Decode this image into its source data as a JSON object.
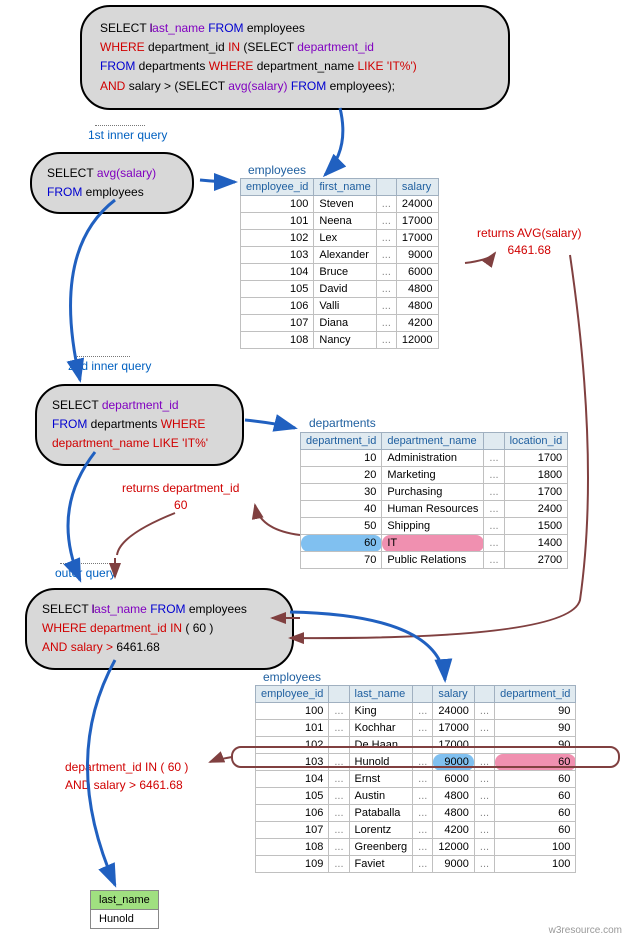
{
  "main_query": {
    "l1a": "SELECT",
    "l1b": "last_name",
    "l1c": "FROM",
    "l1d": "employees",
    "l2a": "WHERE",
    "l2b": "department_id",
    "l2c": "IN",
    "l2d": "(SELECT",
    "l2e": "department_id",
    "l3a": "FROM",
    "l3b": "departments",
    "l3c": "WHERE",
    "l3d": "department_name",
    "l3e": "LIKE",
    "l3f": "'IT%')",
    "l4a": "AND",
    "l4b": "salary >",
    "l4c": "(SELECT",
    "l4d": "avg(salary)",
    "l4e": "FROM",
    "l4f": "employees);"
  },
  "labels": {
    "q1": "1st inner query",
    "q2": "2nd inner query",
    "q3": "outer query",
    "t_emp": "employees",
    "t_dep": "departments",
    "ret_avg": "returns AVG(salary)",
    "ret_avg_val": "6461.68",
    "ret_dept": "returns department_id",
    "ret_dept_val": "60",
    "cond1": "department_id IN ( 60 )",
    "cond2": "AND salary > 6461.68"
  },
  "inner1": {
    "l1a": "SELECT",
    "l1b": "avg(salary)",
    "l2a": "FROM",
    "l2b": "employees"
  },
  "inner2": {
    "l1a": "SELECT",
    "l1b": "department_id",
    "l2a": "FROM",
    "l2b": "departments",
    "l2c": "WHERE",
    "l3a": "department_name",
    "l3b": "LIKE",
    "l3c": "'IT%'"
  },
  "outer": {
    "l1a": "SELECT",
    "l1b": "last_name",
    "l1c": "FROM",
    "l1d": "employees",
    "l2a": "WHERE",
    "l2b": "department_id",
    "l2c": "IN",
    "l2d": "( 60 )",
    "l3a": "AND",
    "l3b": "salary >",
    "l3c": "6461.68"
  },
  "emp1": {
    "headers": [
      "employee_id",
      "first_name",
      "",
      "salary"
    ],
    "rows": [
      [
        "100",
        "Steven",
        "...",
        "24000"
      ],
      [
        "101",
        "Neena",
        "...",
        "17000"
      ],
      [
        "102",
        "Lex",
        "...",
        "17000"
      ],
      [
        "103",
        "Alexander",
        "...",
        "9000"
      ],
      [
        "104",
        "Bruce",
        "...",
        "6000"
      ],
      [
        "105",
        "David",
        "...",
        "4800"
      ],
      [
        "106",
        "Valli",
        "...",
        "4800"
      ],
      [
        "107",
        "Diana",
        "...",
        "4200"
      ],
      [
        "108",
        "Nancy",
        "...",
        "12000"
      ]
    ]
  },
  "dep": {
    "headers": [
      "department_id",
      "department_name",
      "",
      "location_id"
    ],
    "rows": [
      [
        "10",
        "Administration",
        "...",
        "1700"
      ],
      [
        "20",
        "Marketing",
        "...",
        "1800"
      ],
      [
        "30",
        "Purchasing",
        "...",
        "1700"
      ],
      [
        "40",
        "Human Resources",
        "...",
        "2400"
      ],
      [
        "50",
        "Shipping",
        "...",
        "1500"
      ],
      [
        "60",
        "IT",
        "...",
        "1400"
      ],
      [
        "70",
        "Public Relations",
        "...",
        "2700"
      ]
    ]
  },
  "emp2": {
    "headers": [
      "employee_id",
      "",
      "last_name",
      "",
      "salary",
      "",
      "department_id"
    ],
    "rows": [
      [
        "100",
        "...",
        "King",
        "...",
        "24000",
        "...",
        "90"
      ],
      [
        "101",
        "...",
        "Kochhar",
        "...",
        "17000",
        "...",
        "90"
      ],
      [
        "102",
        "...",
        "De Haan",
        "...",
        "17000",
        "...",
        "90"
      ],
      [
        "103",
        "...",
        "Hunold",
        "...",
        "9000",
        "...",
        "60"
      ],
      [
        "104",
        "...",
        "Ernst",
        "...",
        "6000",
        "...",
        "60"
      ],
      [
        "105",
        "...",
        "Austin",
        "...",
        "4800",
        "...",
        "60"
      ],
      [
        "106",
        "...",
        "Pataballa",
        "...",
        "4800",
        "...",
        "60"
      ],
      [
        "107",
        "...",
        "Lorentz",
        "...",
        "4200",
        "...",
        "60"
      ],
      [
        "108",
        "...",
        "Greenberg",
        "...",
        "12000",
        "...",
        "100"
      ],
      [
        "109",
        "...",
        "Faviet",
        "...",
        "9000",
        "...",
        "100"
      ]
    ]
  },
  "result": {
    "header": "last_name",
    "value": "Hunold"
  },
  "watermark": "w3resource.com"
}
